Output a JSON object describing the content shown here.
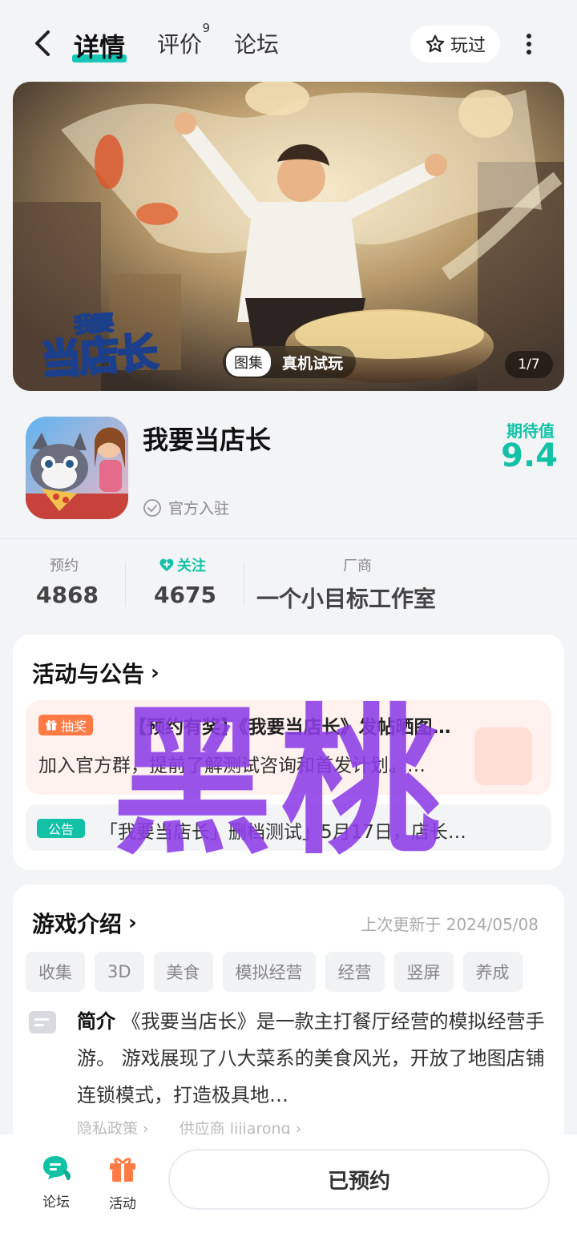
{
  "nav": {
    "tabs": [
      {
        "label": "详情"
      },
      {
        "label": "评价",
        "badge": "9"
      },
      {
        "label": "论坛"
      }
    ],
    "played_label": "玩过"
  },
  "banner": {
    "logo_text_top": "我要",
    "logo_text_bottom": "当店长",
    "chip_label": "图集",
    "trial_label": "真机试玩",
    "counter": "1/7"
  },
  "app": {
    "name": "我要当店长",
    "official_label": "官方入驻",
    "expect_label": "期待值",
    "expect_value": "9.4"
  },
  "stats": {
    "reserve_label": "预约",
    "reserve_value": "4868",
    "follow_label": "关注",
    "follow_value": "4675",
    "vendor_label": "厂商",
    "vendor_value": "一个小目标工作室"
  },
  "activities": {
    "title": "活动与公告",
    "lottery_badge": "抽奖",
    "lottery_title": "【预约有奖】《我要当店长》发帖晒图…",
    "lottery_desc": "加入官方群，提前了解测试咨询和首发计划。…",
    "notice_badge": "公告",
    "notice_text": "「我要当店长」删档测试」5月17日，店长…"
  },
  "intro": {
    "title": "游戏介绍",
    "updated": "上次更新于 2024/05/08",
    "tags": [
      "收集",
      "3D",
      "美食",
      "模拟经营",
      "经营",
      "竖屏",
      "养成"
    ],
    "label": "简介",
    "text": "《我要当店长》是一款主打餐厅经营的模拟经营手游。 游戏展现了八大菜系的美食风光，开放了地图店铺连锁模式，打造极具地…",
    "privacy_link": "隐私政策",
    "supplier_link": "供应商 lijiarong"
  },
  "watermark": "黑桃",
  "bottom": {
    "forum_label": "论坛",
    "activity_label": "活动",
    "reserved_label": "已预约"
  },
  "colors": {
    "accent": "#13c2a6",
    "lottery_orange": "#ff7a45",
    "watermark": "#8c3ce6"
  }
}
